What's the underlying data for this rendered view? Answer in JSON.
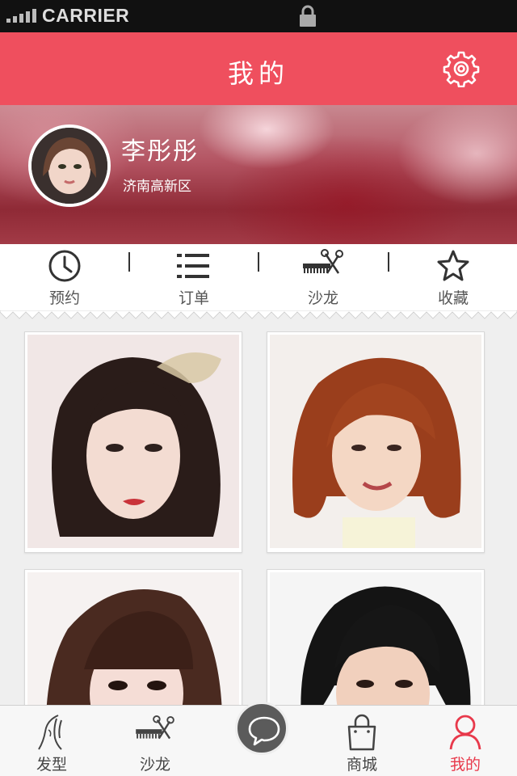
{
  "status_bar": {
    "carrier": "CARRIER"
  },
  "header": {
    "title": "我的"
  },
  "profile": {
    "name": "李彤彤",
    "location": "济南高新区"
  },
  "quick_menu": [
    {
      "label": "预约",
      "icon": "clock-icon"
    },
    {
      "label": "订单",
      "icon": "list-icon"
    },
    {
      "label": "沙龙",
      "icon": "comb-scissors-icon"
    },
    {
      "label": "收藏",
      "icon": "star-icon"
    }
  ],
  "tab_bar": [
    {
      "label": "发型",
      "icon": "hairstyle-icon"
    },
    {
      "label": "沙龙",
      "icon": "comb-scissors-icon"
    },
    {
      "label": "",
      "icon": "chat-bubble-icon"
    },
    {
      "label": "商城",
      "icon": "shopping-bag-icon"
    },
    {
      "label": "我的",
      "icon": "person-icon",
      "active": true
    }
  ],
  "colors": {
    "accent": "#ef4f5e",
    "active_tab": "#e8394b"
  }
}
